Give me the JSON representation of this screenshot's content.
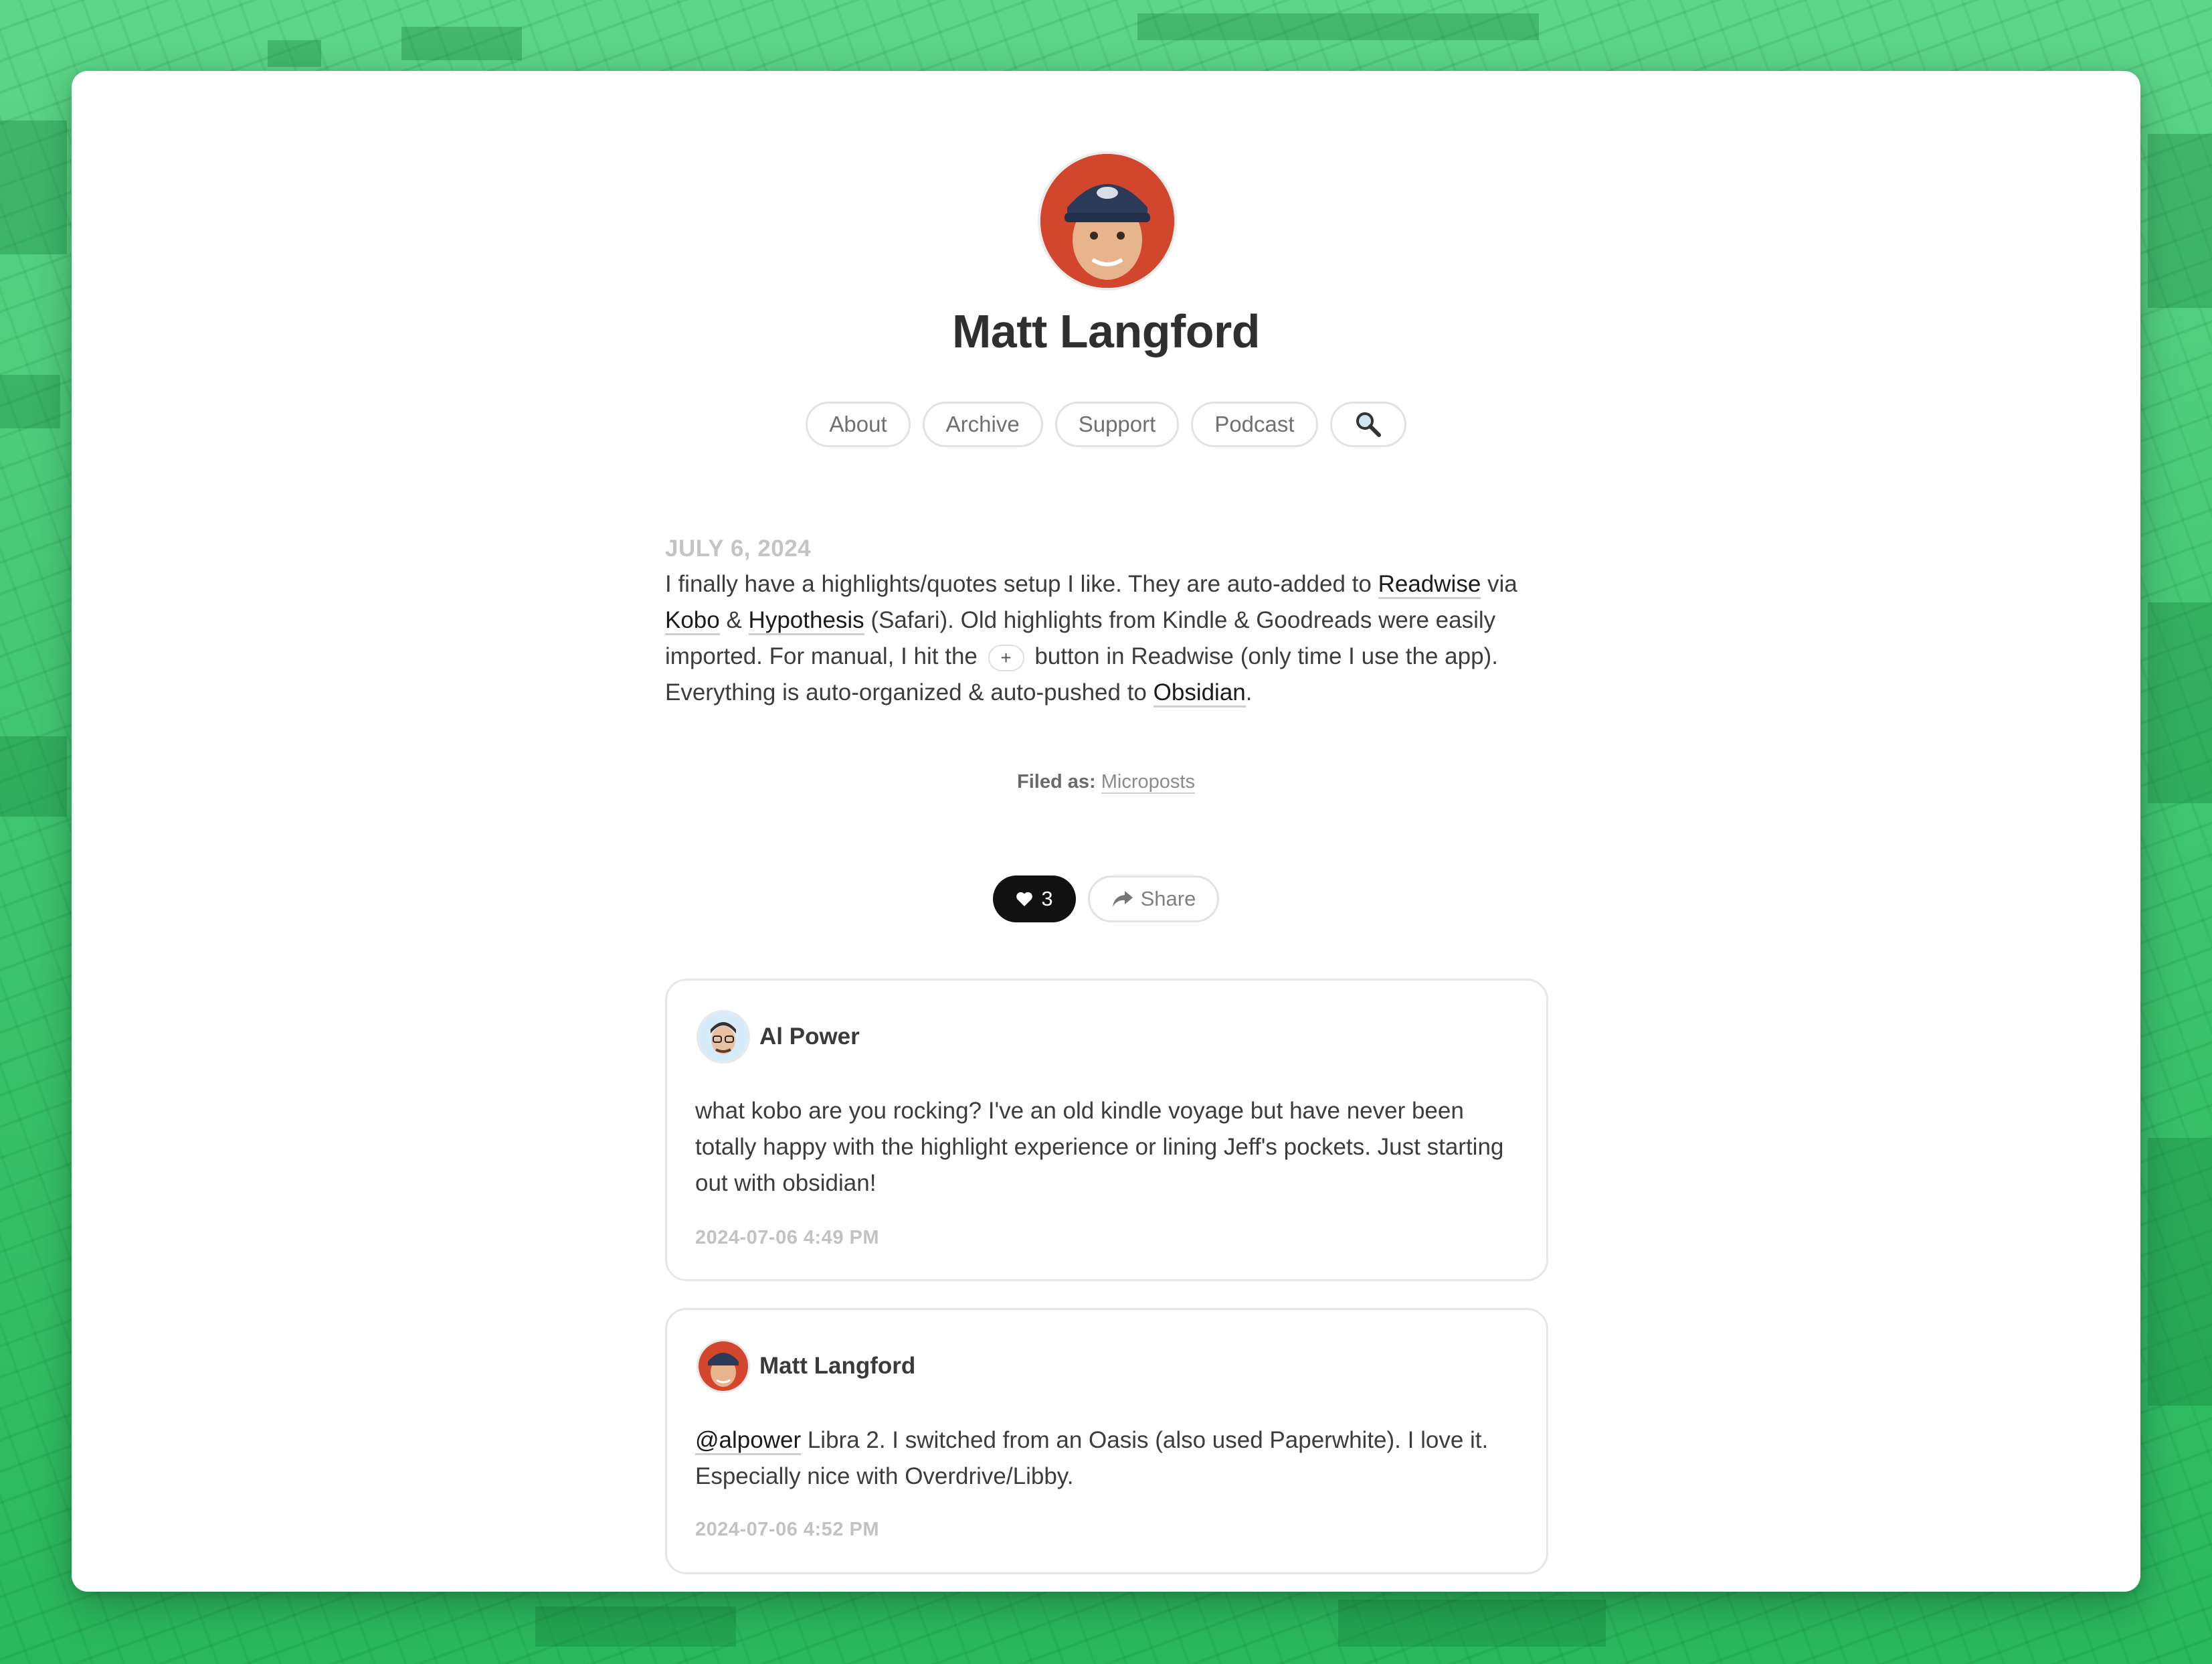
{
  "site": {
    "title": "Matt Langford"
  },
  "nav": {
    "about": "About",
    "archive": "Archive",
    "support": "Support",
    "podcast": "Podcast",
    "search_icon": "magnifier-icon"
  },
  "post": {
    "date": "JULY 6, 2024",
    "t1": "I finally have a highlights/quotes setup I like. They are auto-added to ",
    "link_readwise": "Readwise",
    "t2": " via ",
    "link_kobo": "Kobo",
    "t3": " & ",
    "link_hypothesis": "Hypothesis",
    "t4": " (Safari). Old highlights from Kindle & Goodreads were easily imported. For manual, I hit the ",
    "plus_key": "+",
    "t5": " button in Readwise (only time I use the app). Everything is auto-organized & auto-pushed to ",
    "link_obsidian": "Obsidian",
    "t6": "."
  },
  "filed": {
    "label": "Filed as:",
    "category": "Microposts"
  },
  "actions": {
    "like_count": "3",
    "share_label": "Share"
  },
  "comments": [
    {
      "author": "Al Power",
      "text": "what kobo are you rocking? I've an old kindle voyage but have never been totally happy with the highlight experience or lining Jeff's pockets. Just starting out with obsidian!",
      "time": "2024-07-06 4:49 PM"
    },
    {
      "author": "Matt Langford",
      "mention": "@alpower",
      "text": " Libra 2. I switched from an Oasis (also used Paperwhite). I love it. Especially nice with Overdrive/Libby.",
      "time": "2024-07-06 4:52 PM"
    }
  ],
  "colors": {
    "background": "#3fc46f",
    "accent": "#111111"
  }
}
